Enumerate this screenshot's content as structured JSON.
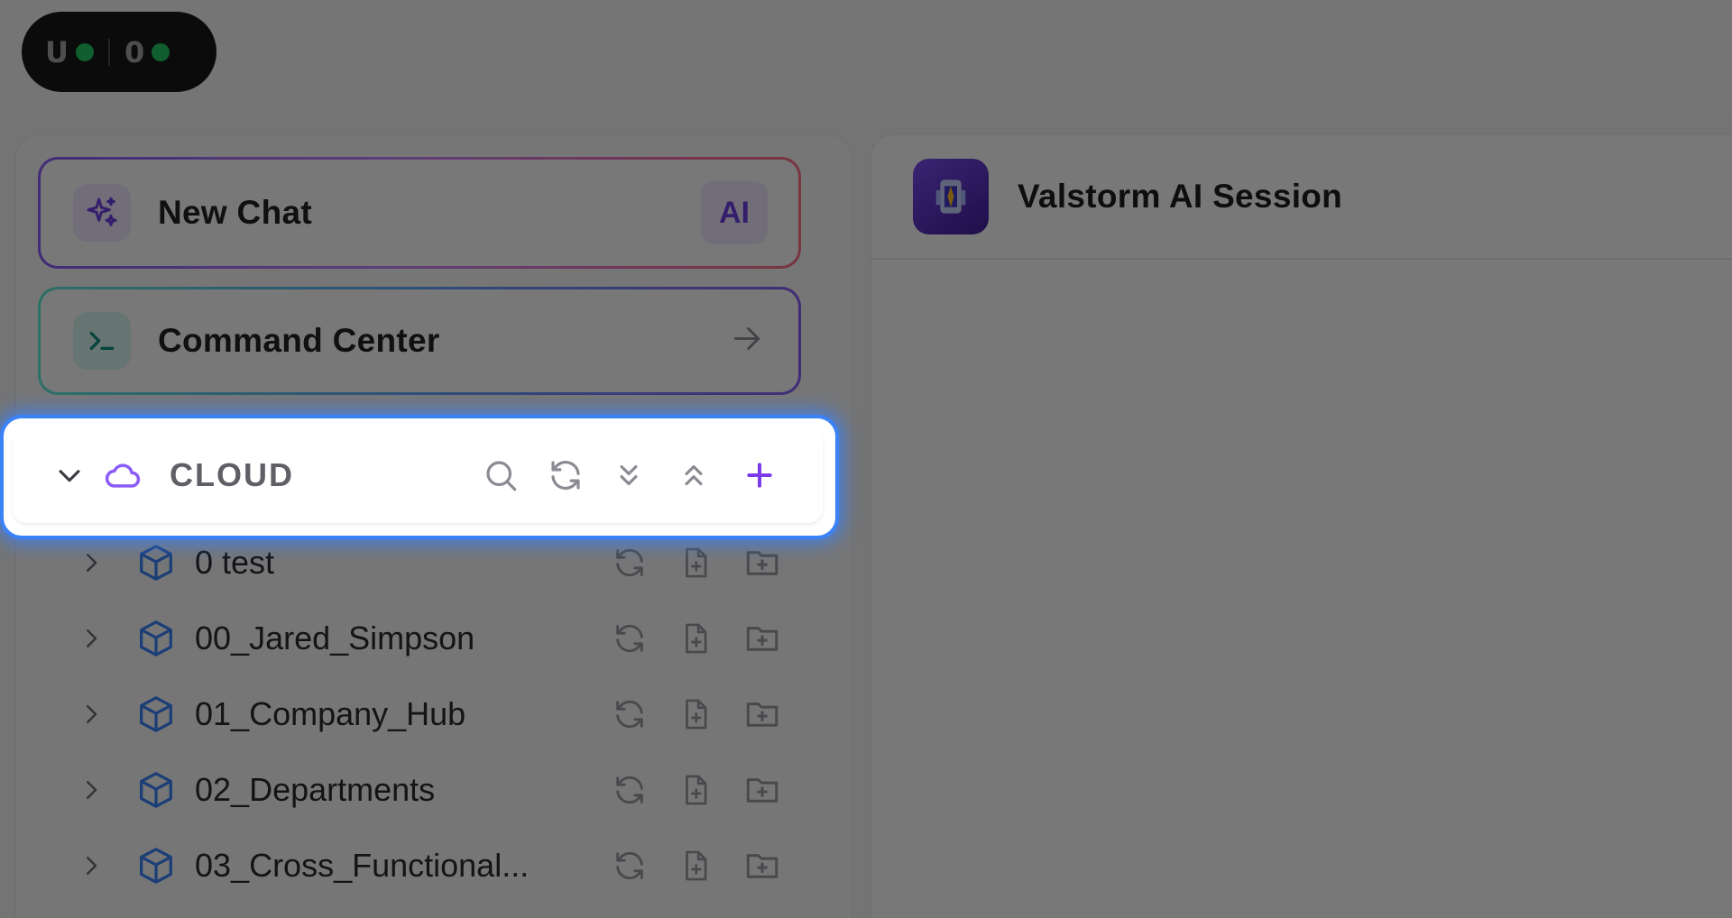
{
  "status_pill": {
    "items": [
      {
        "letter": "U",
        "dot_color": "#22c55e"
      },
      {
        "letter": "0",
        "dot_color": "#22c55e"
      }
    ]
  },
  "sidebar": {
    "new_chat": {
      "label": "New Chat",
      "icon": "sparkles-icon",
      "badge": "AI"
    },
    "command_center": {
      "label": "Command Center",
      "icon": "terminal-icon",
      "trailing_icon": "arrow-right-icon"
    },
    "cloud_section": {
      "label": "CLOUD",
      "icon": "cloud-icon",
      "expanded": true,
      "tools": [
        "search-icon",
        "refresh-icon",
        "expand-all-icon",
        "collapse-all-icon",
        "plus-icon"
      ]
    },
    "tree_items": [
      {
        "label": "0 test"
      },
      {
        "label": "00_Jared_Simpson"
      },
      {
        "label": "01_Company_Hub"
      },
      {
        "label": "02_Departments"
      },
      {
        "label": "03_Cross_Functional..."
      }
    ]
  },
  "main": {
    "session_title": "Valstorm AI Session",
    "logo": "valstorm-logo-icon"
  },
  "colors": {
    "accent_purple": "#7c3aed",
    "highlight_blue": "#3b82f6",
    "tree_icon_blue": "#3b82f6"
  }
}
